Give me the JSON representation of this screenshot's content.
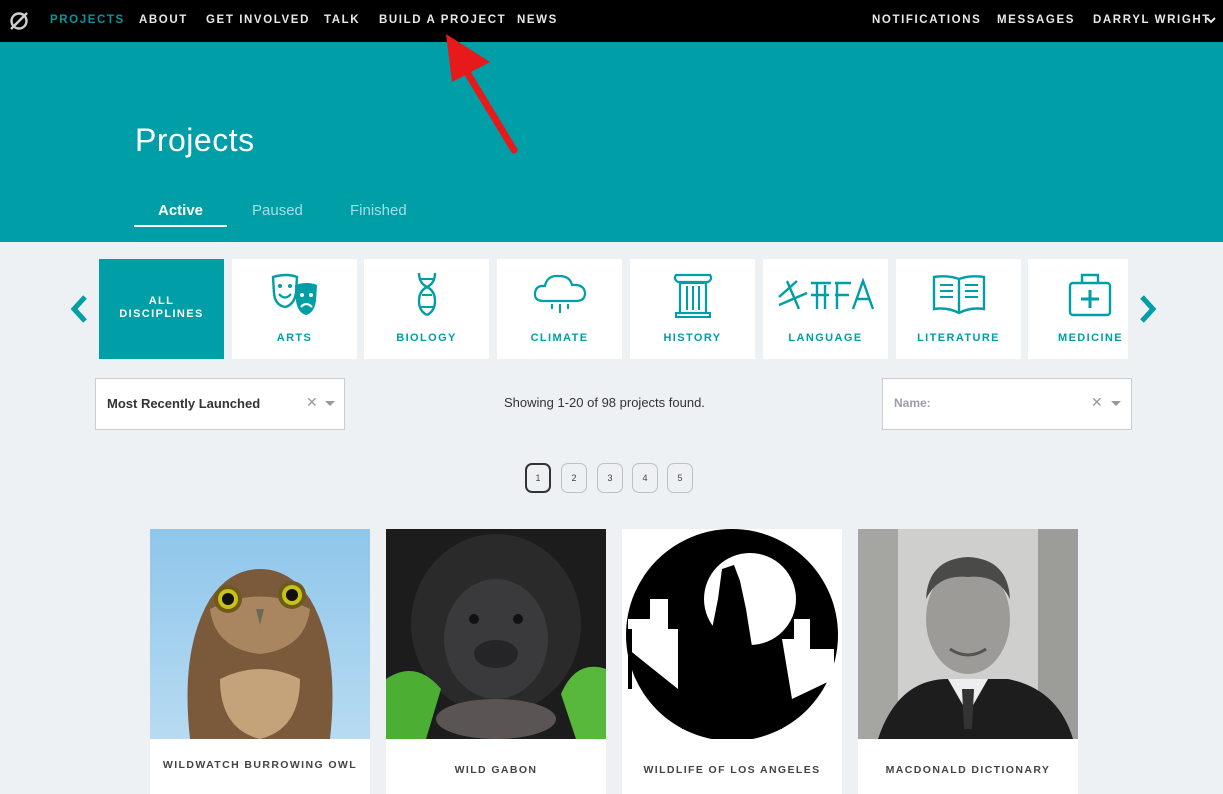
{
  "nav": {
    "items": [
      "PROJECTS",
      "ABOUT",
      "GET INVOLVED",
      "TALK",
      "BUILD A PROJECT",
      "NEWS"
    ],
    "right": [
      "NOTIFICATIONS",
      "MESSAGES",
      "DARRYL WRIGHT"
    ]
  },
  "hero": {
    "title": "Projects",
    "tabs": [
      "Active",
      "Paused",
      "Finished"
    ]
  },
  "disciplines": [
    "ALL DISCIPLINES",
    "ARTS",
    "BIOLOGY",
    "CLIMATE",
    "HISTORY",
    "LANGUAGE",
    "LITERATURE",
    "MEDICINE"
  ],
  "sort": {
    "value": "Most Recently Launched"
  },
  "filter": {
    "placeholder": "Name:"
  },
  "count_text": "Showing 1-20 of 98 projects found.",
  "pagination": [
    "1",
    "2",
    "3",
    "4",
    "5"
  ],
  "projects": [
    "WILDWATCH BURROWING OWL",
    "WILD GABON",
    "WILDLIFE OF LOS ANGELES",
    "MACDONALD DICTIONARY"
  ],
  "colors": {
    "accent": "#009ea6",
    "nav_bg": "#000000",
    "page_bg": "#eef1f4",
    "annotation": "#e8191a"
  },
  "icons": [
    "zooniverse-logo-icon",
    "chevron-down-icon",
    "chevron-left-icon",
    "chevron-right-icon",
    "theater-masks-icon",
    "dna-icon",
    "rain-cloud-icon",
    "column-icon",
    "language-glyphs-icon",
    "open-book-icon",
    "first-aid-kit-icon",
    "clear-icon",
    "caret-down-icon"
  ]
}
